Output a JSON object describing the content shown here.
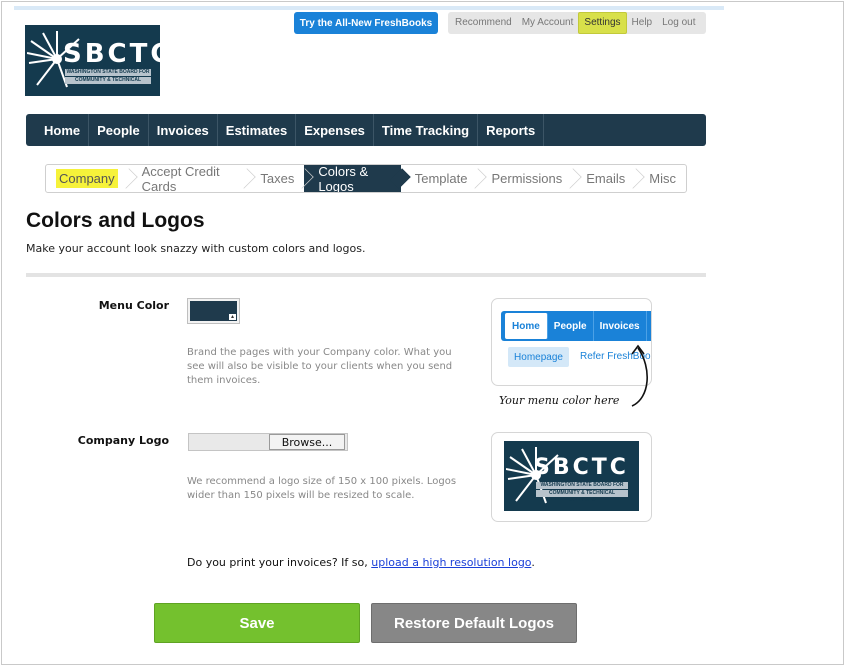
{
  "header": {
    "promo_label": "Try the All-New FreshBooks",
    "links": [
      "Recommend",
      "My Account",
      "Settings",
      "Help",
      "Log out"
    ],
    "active_link": "Settings"
  },
  "logo": {
    "letters": "SBCTC",
    "line1": "WASHINGTON STATE BOARD FOR",
    "line2": "COMMUNITY & TECHNICAL COLLEGES"
  },
  "main_nav": [
    "Home",
    "People",
    "Invoices",
    "Estimates",
    "Expenses",
    "Time Tracking",
    "Reports"
  ],
  "sub_nav": [
    "Company",
    "Accept Credit Cards",
    "Taxes",
    "Colors & Logos",
    "Template",
    "Permissions",
    "Emails",
    "Misc"
  ],
  "sub_nav_active": "Colors & Logos",
  "page": {
    "title": "Colors and Logos",
    "subtitle": "Make your account look snazzy with custom colors and logos."
  },
  "menu_color": {
    "label": "Menu Color",
    "help_line1": "Brand the pages with your Company color. What you",
    "help_line2": "see will also be visible to your clients when you send",
    "help_line3": "them invoices.",
    "value": "#1f3a4c",
    "preview_nav": [
      "Home",
      "People",
      "Invoices"
    ],
    "preview_sub1": "Homepage",
    "preview_sub2": "Refer FreshBoo",
    "note": "Your menu color here"
  },
  "company_logo": {
    "label": "Company Logo",
    "browse_label": "Browse...",
    "help_line1": "We recommend a logo size of 150 x 100 pixels. Logos",
    "help_line2": "wider than 150 pixels will be resized to scale."
  },
  "print_note": {
    "text": "Do you print your invoices? If so, ",
    "link": "upload a high resolution logo",
    "end": "."
  },
  "buttons": {
    "save": "Save",
    "restore": "Restore Default Logos"
  },
  "colors": {
    "nav_dark": "#1f3a4c",
    "accent_blue": "#1a82d8",
    "save_green": "#74c12e",
    "restore_gray": "#878787",
    "highlight_yellow": "#f6f23a"
  }
}
